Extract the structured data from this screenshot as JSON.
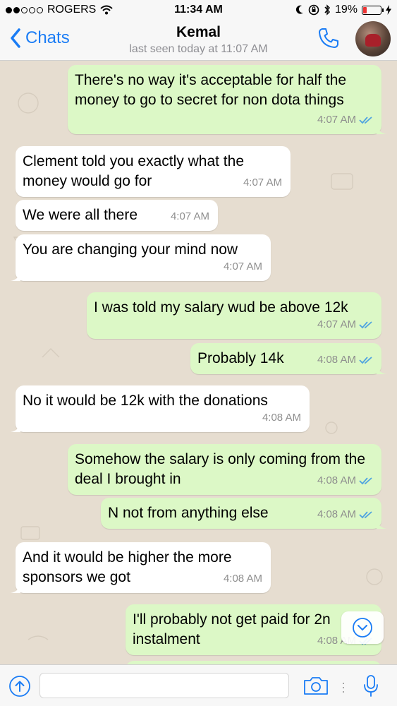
{
  "status_bar": {
    "carrier": "ROGERS",
    "time": "11:34 AM",
    "battery_percent": "19%",
    "battery_level": 0.19
  },
  "nav": {
    "back_label": "Chats",
    "contact_name": "Kemal",
    "last_seen": "last seen today at 11:07 AM"
  },
  "messages": [
    {
      "dir": "out",
      "text": "There's no way it's acceptable for half the money to go to secret for non dota things",
      "time": "4:07 AM",
      "status": "read"
    },
    {
      "dir": "in",
      "text": "Clement told you exactly what the money would go for",
      "time": "4:07 AM"
    },
    {
      "dir": "in",
      "text": "We were all there",
      "time": "4:07 AM"
    },
    {
      "dir": "in",
      "text": "You are changing your mind now",
      "time": "4:07 AM"
    },
    {
      "dir": "out",
      "text": "I was told my salary wud be above 12k",
      "time": "4:07 AM",
      "status": "read"
    },
    {
      "dir": "out",
      "text": "Probably 14k",
      "time": "4:08 AM",
      "status": "read"
    },
    {
      "dir": "in",
      "text": "No it would be 12k with the donations",
      "time": "4:08 AM"
    },
    {
      "dir": "out",
      "text": "Somehow the salary is only coming from the deal I brought in",
      "time": "4:08 AM",
      "status": "read"
    },
    {
      "dir": "out",
      "text": "N not from anything else",
      "time": "4:08 AM",
      "status": "read"
    },
    {
      "dir": "in",
      "text": "And it would be higher the more sponsors we got",
      "time": "4:08 AM"
    },
    {
      "dir": "out",
      "text": "I'll probably not get paid for 2n instalment",
      "time": "4:08 AM",
      "status": "read"
    }
  ],
  "colors": {
    "accent": "#1a7cf5",
    "incoming_bubble": "#ffffff",
    "outgoing_bubble": "#dcf8c6",
    "read_ticks": "#4fa3e0",
    "chat_background": "#e6ddd0"
  },
  "input": {
    "placeholder": "",
    "value": ""
  },
  "icons": [
    "back-chevron-icon",
    "phone-icon",
    "scroll-down-icon",
    "upload-icon",
    "camera-icon",
    "microphone-icon",
    "double-check-icon"
  ]
}
